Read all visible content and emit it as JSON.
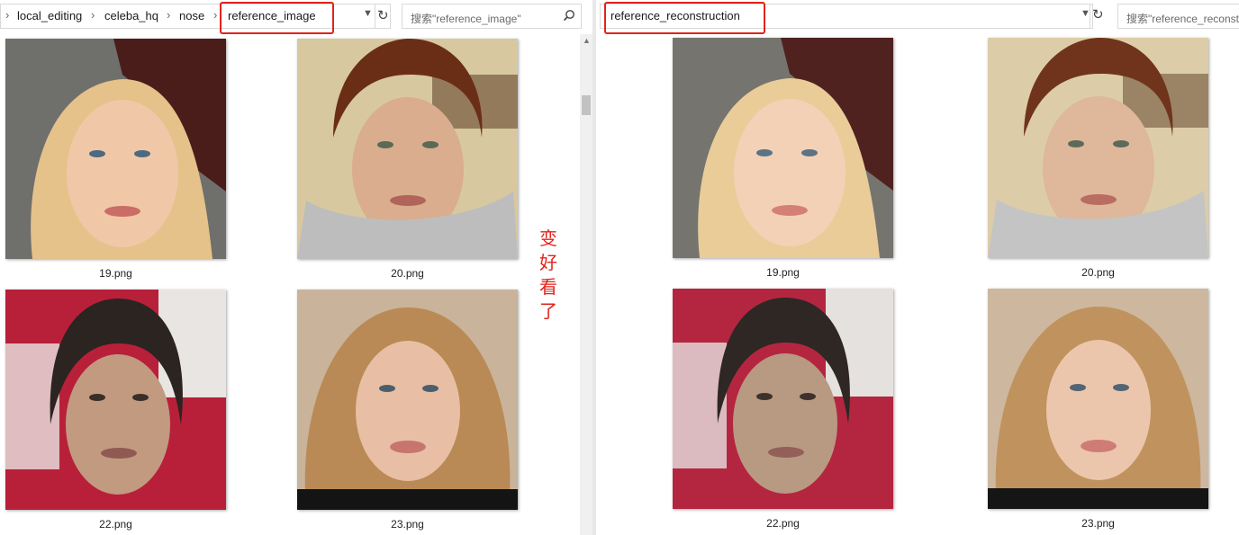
{
  "left": {
    "breadcrumb": [
      "local_editing",
      "celeba_hq",
      "nose",
      "reference_image"
    ],
    "search_placeholder": "搜索\"reference_image\"",
    "files": [
      {
        "name": "19.png"
      },
      {
        "name": "20.png"
      },
      {
        "name": "22.png"
      },
      {
        "name": "23.png"
      }
    ]
  },
  "right": {
    "folder": "reference_reconstruction",
    "search_placeholder": "搜索\"reference_reconstruction\"",
    "files": [
      {
        "name": "19.png"
      },
      {
        "name": "20.png"
      },
      {
        "name": "22.png"
      },
      {
        "name": "23.png"
      }
    ]
  },
  "annotation": {
    "text": "变好看了",
    "color": "#e2231a"
  },
  "icons": {
    "crumb_separator": "chevron-right-icon",
    "dropdown": "chevron-down-icon",
    "refresh": "refresh-icon",
    "search": "search-icon"
  }
}
